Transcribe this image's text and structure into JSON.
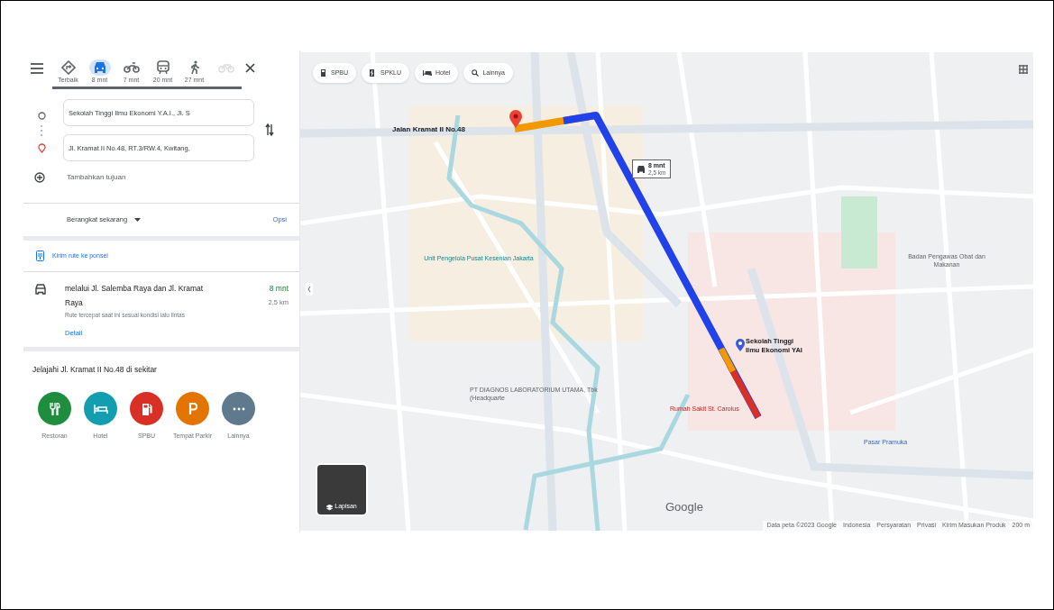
{
  "travel_modes": [
    {
      "kind": "best",
      "label": "Terbaik",
      "selected": false,
      "disabled": false
    },
    {
      "kind": "car",
      "label": "8 mnt",
      "selected": true,
      "disabled": false
    },
    {
      "kind": "motorcycle",
      "label": "7 mnt",
      "selected": false,
      "disabled": false
    },
    {
      "kind": "transit",
      "label": "20 mnt",
      "selected": false,
      "disabled": false
    },
    {
      "kind": "walk",
      "label": "27 mnt",
      "selected": false,
      "disabled": false
    },
    {
      "kind": "bike",
      "selected": false,
      "disabled": true
    }
  ],
  "origin": {
    "value": "Sekolah Tinggi Ilmu Ekonomi Y.A.I., Jl. S"
  },
  "destination": {
    "value": "Jl. Kramat II No.48, RT.3/RW.4, Kwitang,"
  },
  "add_destination": "Tambahkan tujuan",
  "depart": "Berangkat sekarang",
  "options": "Opsi",
  "send_to_phone": "Kirim rute ke ponsel",
  "route": {
    "via": "melalui Jl. Salemba Raya dan Jl. Kramat Raya",
    "duration": "8 mnt",
    "distance": "2,5 km",
    "note": "Rute tercepat saat ini sesuai kondisi lalu lintas",
    "details": "Detail"
  },
  "explore": {
    "title": "Jelajahi Jl. Kramat II No.48 di sekitar",
    "items": [
      {
        "kind": "restaurant",
        "label": "Restoran",
        "color": "#1e8e3e"
      },
      {
        "kind": "hotel",
        "label": "Hotel",
        "color": "#129eaf"
      },
      {
        "kind": "gas",
        "label": "SPBU",
        "color": "#d93025"
      },
      {
        "kind": "parking",
        "label": "Tempat Parkir",
        "color": "#e37400"
      },
      {
        "kind": "more",
        "label": "Lainnya",
        "color": "#5f7a8c"
      }
    ]
  },
  "map": {
    "chips": [
      {
        "kind": "gas",
        "label": "SPBU"
      },
      {
        "kind": "ev",
        "label": "SPKLU"
      },
      {
        "kind": "hotel",
        "label": "Hotel"
      },
      {
        "kind": "search",
        "label": "Lainnya"
      }
    ],
    "destination_label": "Jalan Kramat II No.48",
    "route_callout": {
      "duration": "8 mnt",
      "distance": "2,5 km"
    },
    "origin_label": "Sekolah Tinggi Ilmu Ekonomi YAI",
    "places": [
      {
        "kind": "teal",
        "label": "Unit Pengelola Pusat Kesenian Jakarta"
      },
      {
        "kind": "gray",
        "label": "PT DIAGNOS LABORATORIUM UTAMA, Tbk (Headquarte"
      },
      {
        "kind": "blue",
        "label": "Pasar Pramuka"
      },
      {
        "kind": "gray",
        "label": "Badan Pengawas Obat dan Makanan"
      },
      {
        "kind": "red",
        "label": "Rumah Sakit St. Carolus"
      }
    ],
    "layers_label": "Lapisan",
    "logo": "Google",
    "footer": [
      "Data peta ©2023 Google",
      "Indonesia",
      "Persyaratan",
      "Privasi",
      "Kirim Masukan Produk",
      "200 m"
    ]
  }
}
